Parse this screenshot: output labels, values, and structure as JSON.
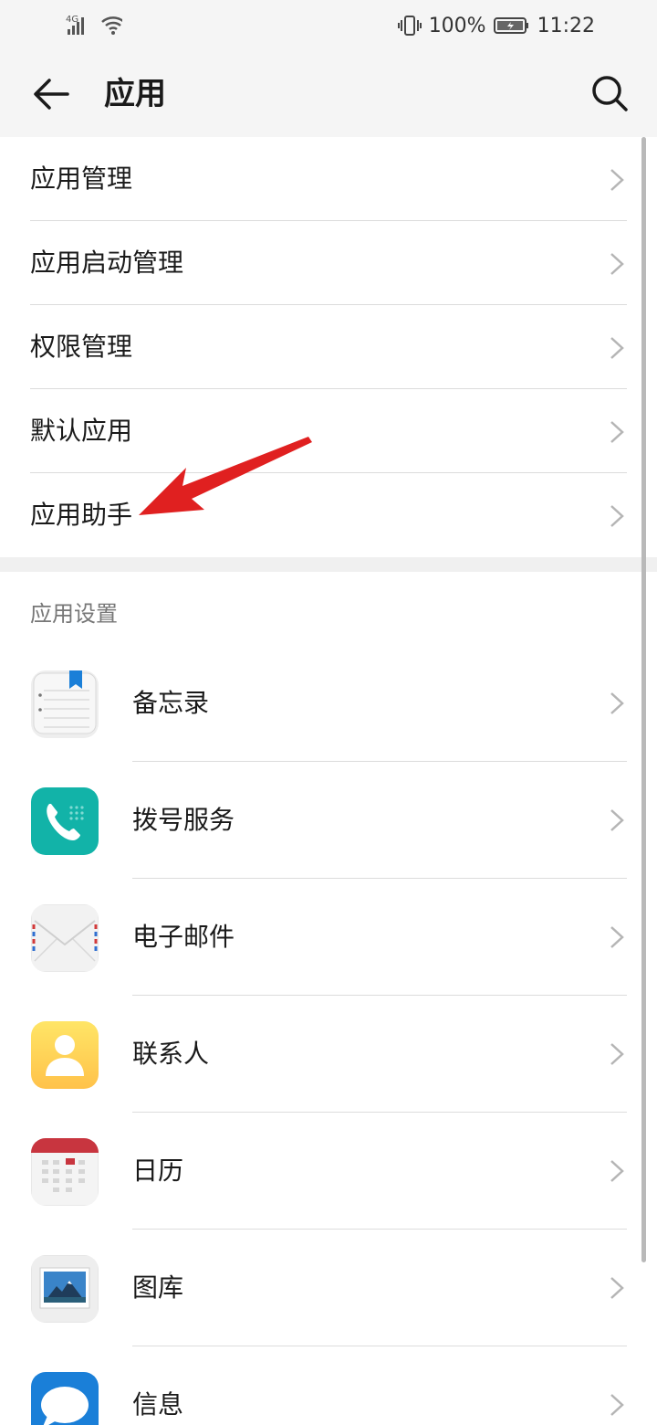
{
  "status_bar": {
    "network": "4G",
    "battery": "100%",
    "time": "11:22"
  },
  "app_bar": {
    "title": "应用",
    "back_icon": "back-arrow-icon",
    "search_icon": "search-icon"
  },
  "menu": {
    "items": [
      {
        "label": "应用管理"
      },
      {
        "label": "应用启动管理"
      },
      {
        "label": "权限管理"
      },
      {
        "label": "默认应用"
      },
      {
        "label": "应用助手"
      }
    ]
  },
  "app_settings": {
    "header": "应用设置",
    "apps": [
      {
        "label": "备忘录",
        "icon": "notepad-icon"
      },
      {
        "label": "拨号服务",
        "icon": "phone-icon"
      },
      {
        "label": "电子邮件",
        "icon": "email-icon"
      },
      {
        "label": "联系人",
        "icon": "contacts-icon"
      },
      {
        "label": "日历",
        "icon": "calendar-icon"
      },
      {
        "label": "图库",
        "icon": "gallery-icon"
      },
      {
        "label": "信息",
        "icon": "messages-icon"
      }
    ]
  },
  "colors": {
    "annotation": "#e02020",
    "accent_teal": "#12b3a8",
    "calendar_red": "#c8353f",
    "message_blue": "#1a7fd8"
  }
}
